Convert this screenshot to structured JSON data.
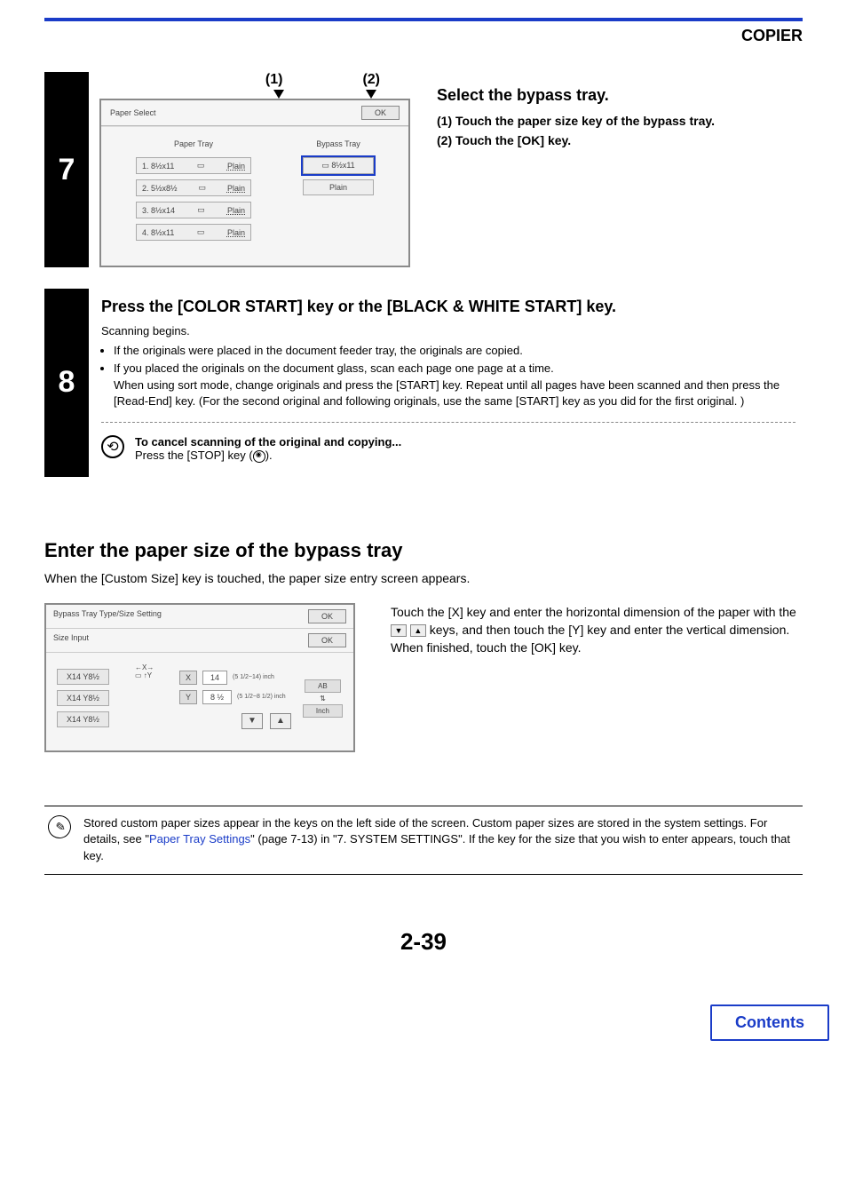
{
  "header": {
    "section": "COPIER"
  },
  "step7": {
    "num": "7",
    "callout1": "(1)",
    "callout2": "(2)",
    "heading": "Select the bypass tray.",
    "item1": "(1)  Touch the paper size key of the bypass tray.",
    "item2": "(2)  Touch the [OK] key.",
    "panel": {
      "title": "Paper Select",
      "ok": "OK",
      "paperTrayTitle": "Paper Tray",
      "bypassTrayTitle": "Bypass Tray",
      "rows": [
        {
          "label": "1. 8½x11",
          "type": "Plain"
        },
        {
          "label": "2. 5½x8½",
          "type": "Plain"
        },
        {
          "label": "3. 8½x14",
          "type": "Plain"
        },
        {
          "label": "4. 8½x11",
          "type": "Plain"
        }
      ],
      "bypassSize": "8½x11",
      "bypassType": "Plain"
    }
  },
  "step8": {
    "num": "8",
    "heading": "Press the [COLOR START] key or the [BLACK & WHITE START] key.",
    "line1": "Scanning begins.",
    "bullet1": "If the originals were placed in the document feeder tray, the originals are copied.",
    "bullet2": "If you placed the originals on the document glass, scan each page one page at a time.",
    "bullet2b": "When using sort mode, change originals and press the [START] key. Repeat until all pages have been scanned and then press the [Read-End] key. (For the second original and following originals, use the same [START] key as you did for the first original. )",
    "cancelTitle": "To cancel scanning of the original and copying...",
    "cancelBody": "Press the [STOP] key ("
  },
  "section2": {
    "heading": "Enter the paper size of the bypass tray",
    "lead": "When the [Custom Size] key is touched, the paper size entry screen appears.",
    "para": "Touch the [X] key and enter the horizontal dimension of the paper with the ",
    "para2": " keys, and then touch the [Y] key and enter the vertical dimension. When finished, touch the [OK] key.",
    "panel": {
      "title": "Bypass Tray Type/Size Setting",
      "subtitle": "Size Input",
      "ok": "OK",
      "chips": [
        "X14  Y8½",
        "X14  Y8½",
        "X14  Y8½"
      ],
      "xLabel": "X",
      "xVal": "14",
      "xRange": "(5 1/2~14)\ninch",
      "yLabel": "Y",
      "yVal": "8    ½",
      "yRange": "(5 1/2~8 1/2)\ninch",
      "ab": "AB",
      "inch": "Inch"
    }
  },
  "note": {
    "textA": "Stored custom paper sizes appear in the keys on the left side of the screen. Custom paper sizes are stored in the system settings. For details, see \"",
    "link": "Paper Tray Settings",
    "textB": "\" (page 7-13) in \"7. SYSTEM SETTINGS\". If the key for the size that you wish to enter appears, touch that key."
  },
  "footer": {
    "page": "2-39",
    "contents": "Contents"
  }
}
